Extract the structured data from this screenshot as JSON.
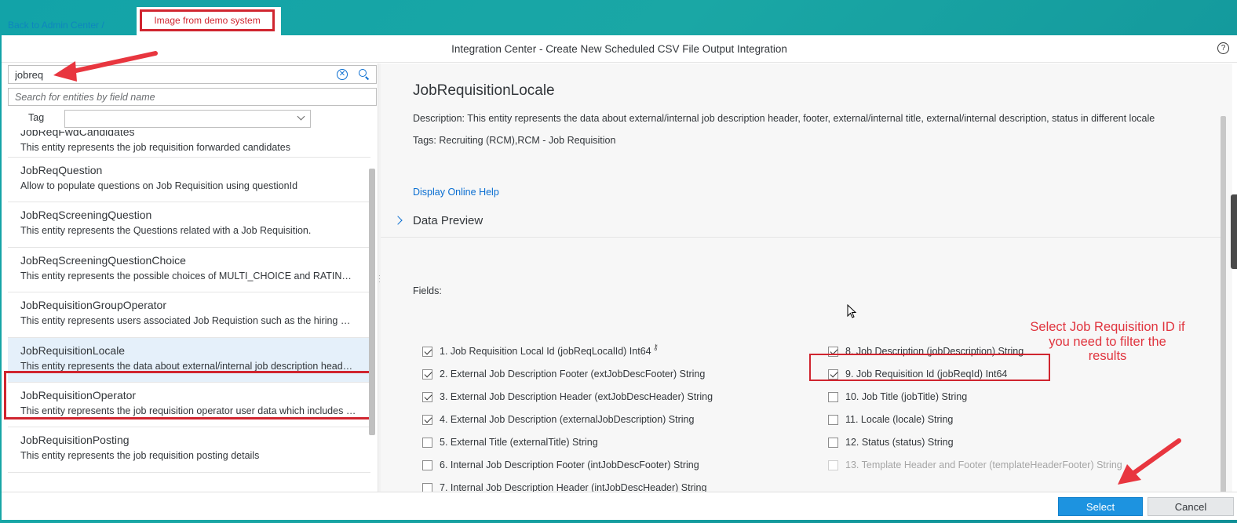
{
  "top_link": "Back to Admin Center /",
  "demo_label": "Image from demo system",
  "dialog": {
    "title": "Integration Center - Create New Scheduled CSV File Output Integration",
    "help_icon": "?"
  },
  "left_panel": {
    "search_value": "jobreq",
    "field_search_placeholder": "Search for entities by field name",
    "tag_label": "Tag",
    "entities": [
      {
        "name": "JobReqFwdCandidates",
        "description": "This entity represents the job requisition forwarded candidates"
      },
      {
        "name": "JobReqQuestion",
        "description": "Allow to populate questions on Job Requisition using questionId"
      },
      {
        "name": "JobReqScreeningQuestion",
        "description": "This entity represents the Questions related with a Job Requisition."
      },
      {
        "name": "JobReqScreeningQuestionChoice",
        "description": "This entity represents the possible choices of MULTI_CHOICE and RATING questions"
      },
      {
        "name": "JobRequisitionGroupOperator",
        "description": "This entity represents users associated Job Requistion such as the hiring manager"
      },
      {
        "name": "JobRequisitionLocale",
        "description": "This entity represents the data about external/internal job description header and footer"
      },
      {
        "name": "JobRequisitionOperator",
        "description": "This entity represents the job requisition operator user data which includes the operator"
      },
      {
        "name": "JobRequisitionPosting",
        "description": "This entity represents the job requisition posting details"
      }
    ],
    "selected_index": 5
  },
  "right_panel": {
    "entity_title": "JobRequisitionLocale",
    "description": "Description: This entity represents the data about external/internal job description header, footer, external/internal title, external/internal description, status in different locale",
    "tags": "Tags: Recruiting (RCM),RCM - Job Requisition",
    "help_link": "Display Online Help",
    "data_preview": "Data Preview",
    "fields_label": "Fields:",
    "fields_left": [
      {
        "label": "1. Job Requisition Local Id (jobReqLocalId) Int64",
        "checked": true,
        "key": true
      },
      {
        "label": "2. External Job Description Footer (extJobDescFooter) String",
        "checked": true
      },
      {
        "label": "3. External Job Description Header (extJobDescHeader) String",
        "checked": true
      },
      {
        "label": "4. External Job Description (externalJobDescription) String",
        "checked": true
      },
      {
        "label": "5. External Title (externalTitle) String",
        "checked": false
      },
      {
        "label": "6. Internal Job Description Footer (intJobDescFooter) String",
        "checked": false
      },
      {
        "label": "7. Internal Job Description Header (intJobDescHeader) String",
        "checked": false
      }
    ],
    "fields_right": [
      {
        "label": "8. Job Description (jobDescription) String",
        "checked": true
      },
      {
        "label": "9. Job Requisition Id (jobReqId) Int64",
        "checked": true
      },
      {
        "label": "10. Job Title (jobTitle) String",
        "checked": false
      },
      {
        "label": "11. Locale (locale) String",
        "checked": false
      },
      {
        "label": "12. Status (status) String",
        "checked": false
      },
      {
        "label": "13. Template Header and Footer (templateHeaderFooter) String",
        "checked": false,
        "disabled": true
      }
    ],
    "annotation": "Select Job Requisition ID if you need to filter the results"
  },
  "footer": {
    "select_label": "Select",
    "cancel_label": "Cancel"
  },
  "colors": {
    "accent": "#0a6ed1",
    "annotation_red": "#d0252f",
    "primary_button": "#1d93e0",
    "background_teal": "#12a3a8"
  }
}
